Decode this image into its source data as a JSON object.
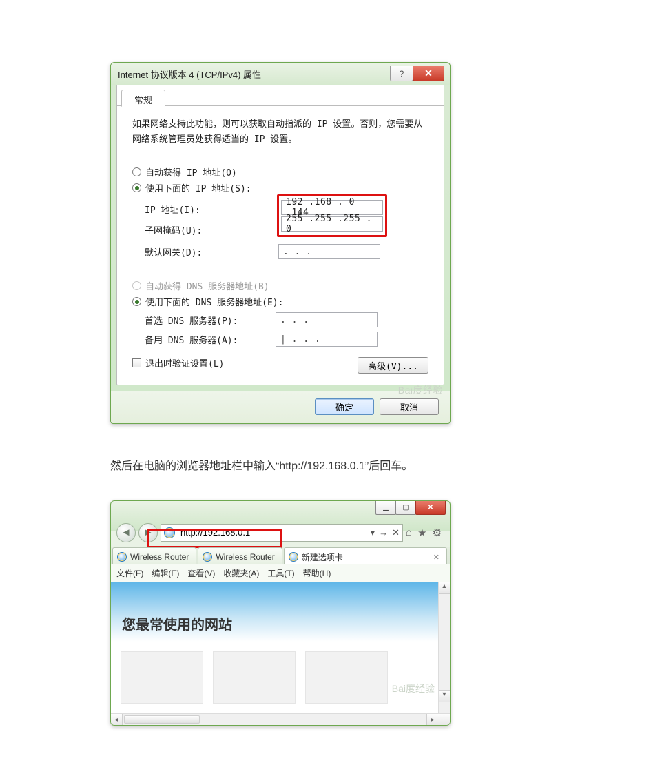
{
  "ipv4": {
    "window_title": "Internet 协议版本 4 (TCP/IPv4) 属性",
    "tab_label": "常规",
    "description": "如果网络支持此功能，则可以获取自动指派的 IP 设置。否则，您需要从网络系统管理员处获得适当的 IP 设置。",
    "radio_auto_ip": "自动获得 IP 地址(O)",
    "radio_use_ip": "使用下面的 IP 地址(S):",
    "label_ip": "IP 地址(I):",
    "label_mask": "子网掩码(U):",
    "label_gateway": "默认网关(D):",
    "value_ip": "192 .168 . 0  .144",
    "value_mask": "255 .255 .255 . 0",
    "value_gateway": ".     .     .",
    "radio_auto_dns": "自动获得 DNS 服务器地址(B)",
    "radio_use_dns": "使用下面的 DNS 服务器地址(E):",
    "label_pref_dns": "首选 DNS 服务器(P):",
    "label_alt_dns": "备用 DNS 服务器(A):",
    "value_pref_dns": ".     .     .",
    "value_alt_dns": "|    .     .     .",
    "check_validate": "退出时验证设置(L)",
    "btn_advanced": "高级(V)...",
    "btn_ok": "确定",
    "btn_cancel": "取消",
    "watermark": "Bai度经验"
  },
  "paragraph": "然后在电脑的浏览器地址栏中输入“http://192.168.0.1”后回车。",
  "ie": {
    "address": "http://192.168.0.1",
    "addr_dropdown": "▾",
    "addr_refresh": "→",
    "addr_stop": "✕",
    "tabs": [
      {
        "label": "Wireless Router"
      },
      {
        "label": "Wireless Router"
      },
      {
        "label": "新建选项卡",
        "active": true,
        "closable": true
      }
    ],
    "menus": [
      "文件(F)",
      "编辑(E)",
      "查看(V)",
      "收藏夹(A)",
      "工具(T)",
      "帮助(H)"
    ],
    "banner_heading": "您最常使用的网站",
    "watermark": "Bai度经验"
  }
}
